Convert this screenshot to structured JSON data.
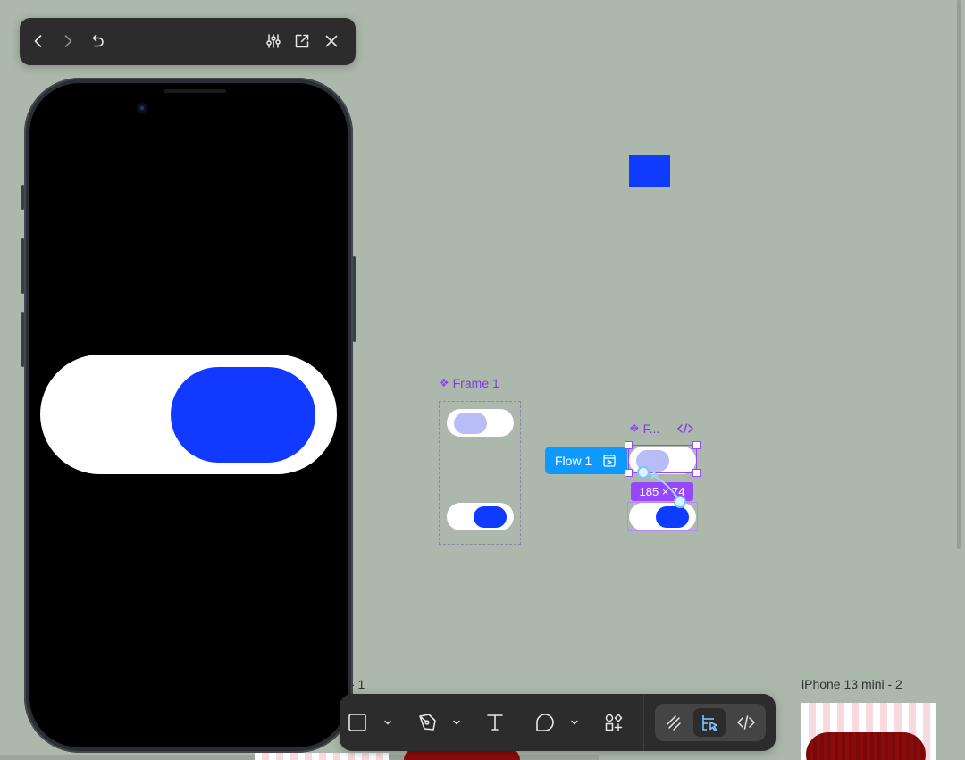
{
  "preview_toolbar": {
    "icons": [
      "chevron-left-icon",
      "chevron-right-icon",
      "restart-icon",
      "sliders-icon",
      "open-external-icon",
      "close-icon"
    ]
  },
  "phone_preview": {
    "toggle_state": "on",
    "knob_color": "#1239ff",
    "track_color": "#ffffff"
  },
  "canvas": {
    "frame1": {
      "label": "Frame 1"
    },
    "frame2": {
      "label": "F..."
    },
    "flow": {
      "label": "Flow 1"
    },
    "size_badge": "185 × 74",
    "iphone2_label": "iPhone 13 mini - 2",
    "frame_dash_label": "- 1",
    "colors": {
      "accent_blue": "#0f3bff",
      "selection_purple": "#9747ff",
      "flow_blue": "#0d99ff",
      "knob_light": "#b8bdf7"
    }
  },
  "main_toolbar": {
    "tools": [
      "frame-tool-icon",
      "pen-tool-icon",
      "text-tool-icon",
      "comment-tool-icon",
      "actions-tool-icon"
    ],
    "modes": [
      "draw-mode-icon",
      "design-mode-icon",
      "dev-mode-icon"
    ],
    "active_mode": "design-mode-icon"
  }
}
